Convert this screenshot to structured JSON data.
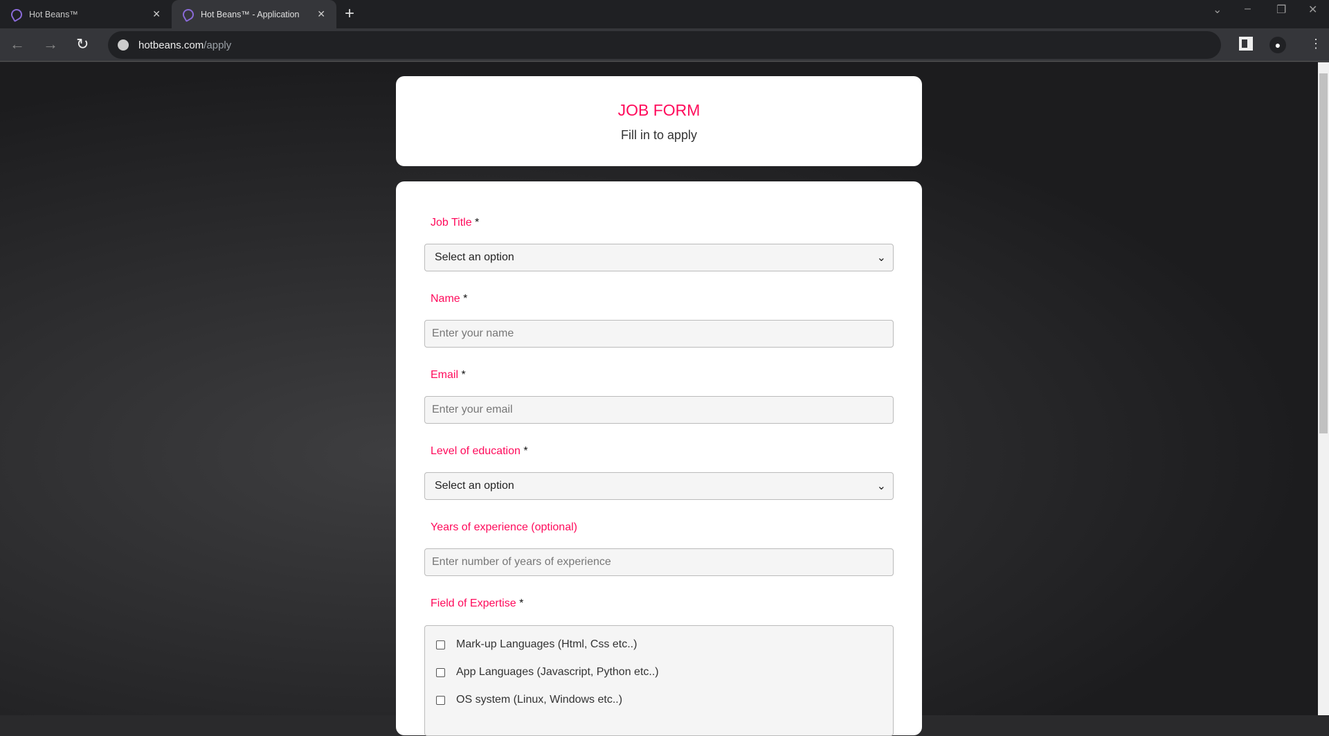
{
  "browser": {
    "tabs": [
      {
        "label": "Hot Beans™"
      },
      {
        "label": "Hot Beans™ - Application",
        "active": true
      }
    ],
    "url_host": "hotbeans.com",
    "url_path": "/apply"
  },
  "header": {
    "title": "JOB FORM",
    "subtitle": "Fill in to apply"
  },
  "form": {
    "required_mark": "*",
    "job_title": {
      "label": "Job Title",
      "value": "Select an option"
    },
    "name": {
      "label": "Name",
      "placeholder": "Enter your name"
    },
    "email": {
      "label": "Email",
      "placeholder": "Enter your email"
    },
    "education": {
      "label": "Level of education",
      "value": "Select an option"
    },
    "experience": {
      "label": "Years of experience (optional)",
      "placeholder": "Enter number of years of experience"
    },
    "expertise": {
      "label": "Field of Expertise",
      "options": [
        "Mark-up Languages (Html, Css etc..)",
        "App Languages (Javascript, Python etc..)",
        "OS system (Linux, Windows etc..)"
      ]
    }
  },
  "colors": {
    "accent": "#ff0a5b"
  }
}
